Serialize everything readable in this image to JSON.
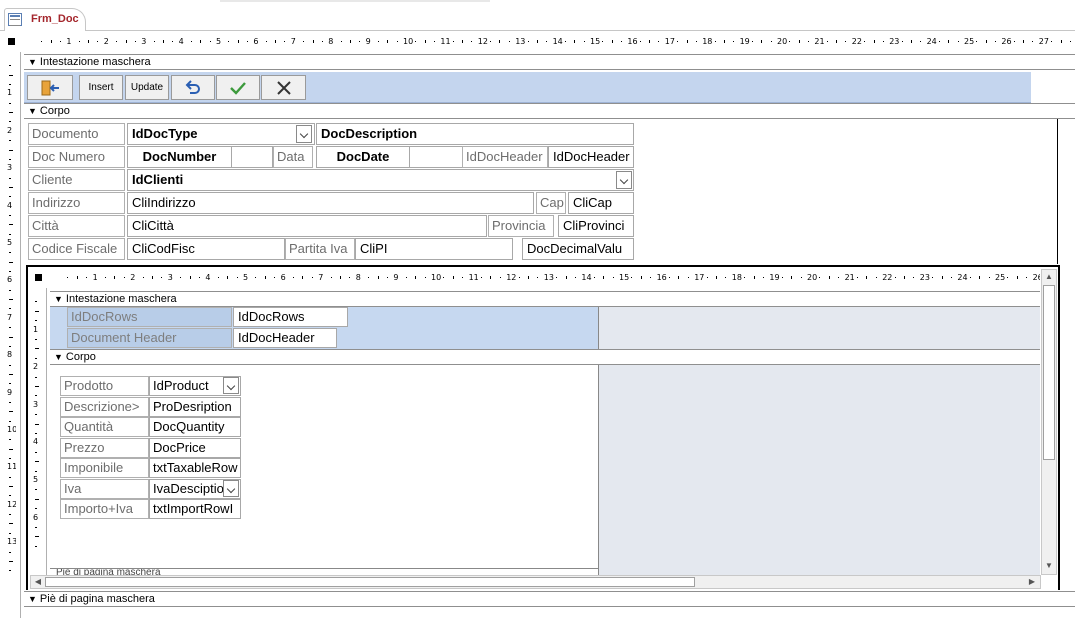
{
  "tab": {
    "title": "Frm_Doc",
    "icon": "form-icon"
  },
  "sections": {
    "header": "Intestazione maschera",
    "body": "Corpo",
    "footer": "Piè di pagina maschera"
  },
  "toolbar": {
    "insert_label": "Insert",
    "update_label": "Update"
  },
  "main_form": {
    "documento_label": "Documento",
    "id_doc_type": "IdDocType",
    "doc_description": "DocDescription",
    "doc_numero_label": "Doc Numero",
    "doc_number": "DocNumber",
    "data_label": "Data",
    "doc_date": "DocDate",
    "id_doc_header_label": "IdDocHeader",
    "id_doc_header": "IdDocHeader",
    "cliente_label": "Cliente",
    "id_clienti": "IdClienti",
    "indirizzo_label": "Indirizzo",
    "cli_indirizzo": "CliIndirizzo",
    "cap_label": "Cap",
    "cli_cap": "CliCap",
    "citta_label": "Città",
    "cli_citta": "CliCittà",
    "provincia_label": "Provincia",
    "cli_provincia": "CliProvinci",
    "codice_fiscale_label": "Codice Fiscale",
    "cli_cod_fisc": "CliCodFisc",
    "partita_iva_label": "Partita Iva",
    "cli_pi": "CliPI",
    "doc_decimal_value": "DocDecimalValu"
  },
  "subform": {
    "header_label": "Intestazione maschera",
    "body_label": "Corpo",
    "footer_label": "Piè di pagina maschera",
    "id_doc_rows_label": "IdDocRows",
    "id_doc_rows": "IdDocRows",
    "document_header_label": "Document Header",
    "id_doc_header": "IdDocHeader",
    "rows": [
      {
        "label": "Prodotto",
        "field": "IdProduct",
        "dropdown": true
      },
      {
        "label": "Descrizione>",
        "field": "ProDesription",
        "dropdown": false
      },
      {
        "label": "Quantità",
        "field": "DocQuantity",
        "dropdown": false
      },
      {
        "label": "Prezzo",
        "field": "DocPrice",
        "dropdown": false
      },
      {
        "label": "Imponibile",
        "field": "txtTaxableRow",
        "dropdown": false
      },
      {
        "label": "Iva",
        "field": "IvaDesciptio",
        "dropdown": true
      },
      {
        "label": "Importo+Iva",
        "field": "txtImportRowI",
        "dropdown": false
      }
    ]
  },
  "colors": {
    "tab_text": "#a4262c",
    "header_band": "#c4d5ee",
    "check_green": "#3c9a3c"
  }
}
